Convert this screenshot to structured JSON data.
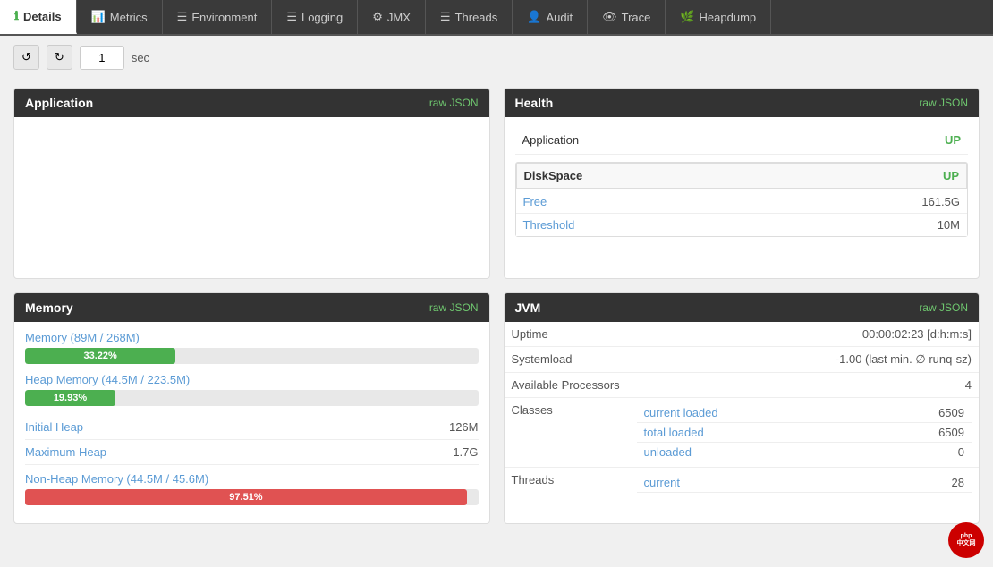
{
  "nav": {
    "tabs": [
      {
        "id": "details",
        "icon": "ℹ",
        "label": "Details",
        "active": true
      },
      {
        "id": "metrics",
        "icon": "📊",
        "label": "Metrics",
        "active": false
      },
      {
        "id": "environment",
        "icon": "☰",
        "label": "Environment",
        "active": false
      },
      {
        "id": "logging",
        "icon": "☰",
        "label": "Logging",
        "active": false
      },
      {
        "id": "jmx",
        "icon": "⚙",
        "label": "JMX",
        "active": false
      },
      {
        "id": "threads",
        "icon": "☰",
        "label": "Threads",
        "active": false
      },
      {
        "id": "audit",
        "icon": "👤",
        "label": "Audit",
        "active": false
      },
      {
        "id": "trace",
        "icon": "👁",
        "label": "Trace",
        "active": false
      },
      {
        "id": "heapdump",
        "icon": "🌿",
        "label": "Heapdump",
        "active": false
      }
    ]
  },
  "toolbar": {
    "refresh_label": "↺",
    "auto_refresh_label": "↻",
    "interval_value": "1",
    "interval_unit": "sec"
  },
  "application_card": {
    "title": "Application",
    "raw_json_label": "raw JSON"
  },
  "health_card": {
    "title": "Health",
    "raw_json_label": "raw JSON",
    "app_label": "Application",
    "app_status": "UP",
    "diskspace_label": "DiskSpace",
    "diskspace_status": "UP",
    "free_label": "Free",
    "free_value": "161.5G",
    "threshold_label": "Threshold",
    "threshold_value": "10M"
  },
  "memory_card": {
    "title": "Memory",
    "raw_json_label": "raw JSON",
    "memory_label": "Memory (89M / 268M)",
    "memory_pct": "33.22%",
    "memory_pct_num": 33.22,
    "heap_label": "Heap Memory (44.5M / 223.5M)",
    "heap_pct": "19.93%",
    "heap_pct_num": 19.93,
    "initial_heap_label": "Initial Heap",
    "initial_heap_value": "126M",
    "max_heap_label": "Maximum Heap",
    "max_heap_value": "1.7G",
    "nonheap_label": "Non-Heap Memory (44.5M / 45.6M)",
    "nonheap_pct": "97.51%",
    "nonheap_pct_num": 97.51
  },
  "jvm_card": {
    "title": "JVM",
    "raw_json_label": "raw JSON",
    "uptime_label": "Uptime",
    "uptime_value": "00:00:02:23 [d:h:m:s]",
    "systemload_label": "Systemload",
    "systemload_value": "-1.00 (last min. ∅ runq-sz)",
    "processors_label": "Available Processors",
    "processors_value": "4",
    "classes_label": "Classes",
    "current_loaded_label": "current loaded",
    "current_loaded_value": "6509",
    "total_loaded_label": "total loaded",
    "total_loaded_value": "6509",
    "unloaded_label": "unloaded",
    "unloaded_value": "0",
    "threads_label": "Threads",
    "threads_current_label": "current",
    "threads_current_value": "28"
  },
  "colors": {
    "green_bar": "#4CAF50",
    "red_bar": "#e05252",
    "status_up": "#4CAF50",
    "link_blue": "#5b9bd5"
  }
}
